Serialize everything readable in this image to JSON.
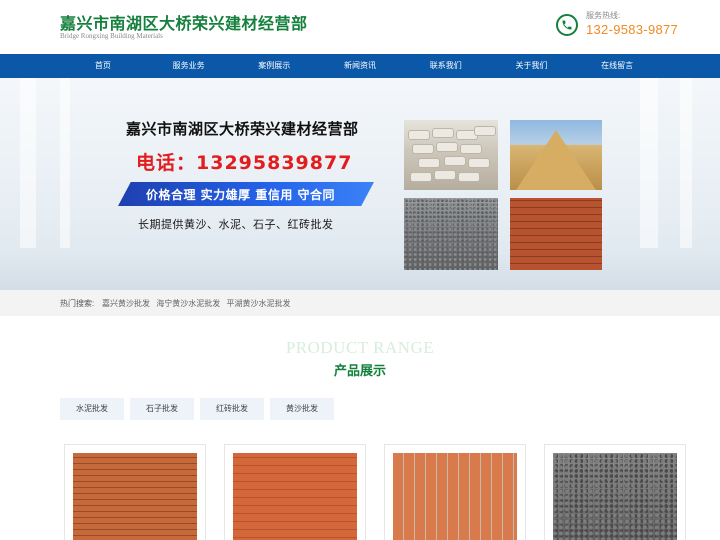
{
  "header": {
    "company_cn": "嘉兴市南湖区大桥荣兴建材经营部",
    "company_en": "Bridge Rongxing Building Materials",
    "hotline_label": "服务热线:",
    "hotline_number": "132-9583-9877",
    "hotline_icon": "phone-icon"
  },
  "nav": {
    "items": [
      "首页",
      "服务业务",
      "案例展示",
      "新闻资讯",
      "联系我们",
      "关于我们",
      "在线留言"
    ]
  },
  "banner": {
    "title": "嘉兴市南湖区大桥荣兴建材经营部",
    "phone_line": "电话：13295839877",
    "slogan": "价格合理  实力雄厚  重信用  守合同",
    "description": "长期提供黄沙、水泥、石子、红砖批发"
  },
  "hot_search": {
    "label": "热门搜索:",
    "links": [
      "嘉兴黄沙批发",
      "海宁黄沙水泥批发",
      "平湖黄沙水泥批发"
    ]
  },
  "products": {
    "title_en": "PRODUCT RANGE",
    "title_cn": "产品展示",
    "categories": [
      "水泥批发",
      "石子批发",
      "红砖批发",
      "黄沙批发"
    ]
  },
  "colors": {
    "brand_green": "#15803d",
    "nav_blue": "#0b58a8",
    "hotline_orange": "#f08a24",
    "banner_red": "#e11d1d"
  }
}
